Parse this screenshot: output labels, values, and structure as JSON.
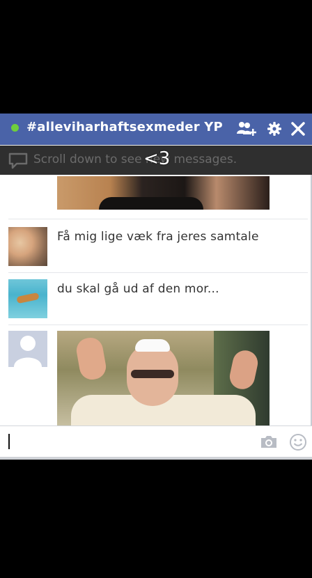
{
  "chat": {
    "title": "#alleviharhaftsexmeder YP",
    "status_color": "#6fcf3c",
    "header_color": "#4a63a8",
    "header_icons": [
      "add-people-icon",
      "gear-icon",
      "close-icon"
    ]
  },
  "notice": {
    "text": "Scroll down to see new messages.",
    "overlay_text": "<3"
  },
  "messages": [
    {
      "type": "photo",
      "sender_avatar": "none"
    },
    {
      "type": "text",
      "text": "Få mig lige væk fra jeres samtale",
      "sender_avatar": "kiss-photo"
    },
    {
      "type": "text",
      "text": "du skal gå ud af den mor...",
      "sender_avatar": "pool-photo"
    },
    {
      "type": "photo",
      "sender_avatar": "default-silhouette"
    }
  ],
  "composer": {
    "value": "",
    "placeholder": "",
    "icons": [
      "camera-icon",
      "emoji-icon"
    ]
  }
}
